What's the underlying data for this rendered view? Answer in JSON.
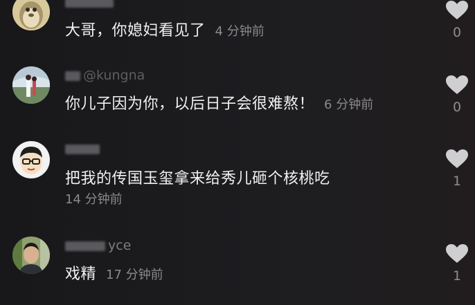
{
  "comments": [
    {
      "username": "",
      "text": "大哥，你媳妇看见了",
      "time": "4 分钟前",
      "likes": "0"
    },
    {
      "username": "@kungna",
      "text": "你儿子因为你，以后日子会很难熬！",
      "time": "6 分钟前",
      "likes": "0"
    },
    {
      "username": "",
      "text": "把我的传国玉玺拿来给秀儿砸个核桃吃",
      "time": "14 分钟前",
      "likes": "1"
    },
    {
      "username": "yce",
      "text": "戏精",
      "time": "17 分钟前",
      "likes": "1"
    }
  ],
  "colors": {
    "background": "#1b1b1e",
    "text": "#f1f1f1",
    "muted": "#8a8a8d",
    "like_icon": "#cfcfd1"
  },
  "icons": [
    "heart-icon"
  ]
}
